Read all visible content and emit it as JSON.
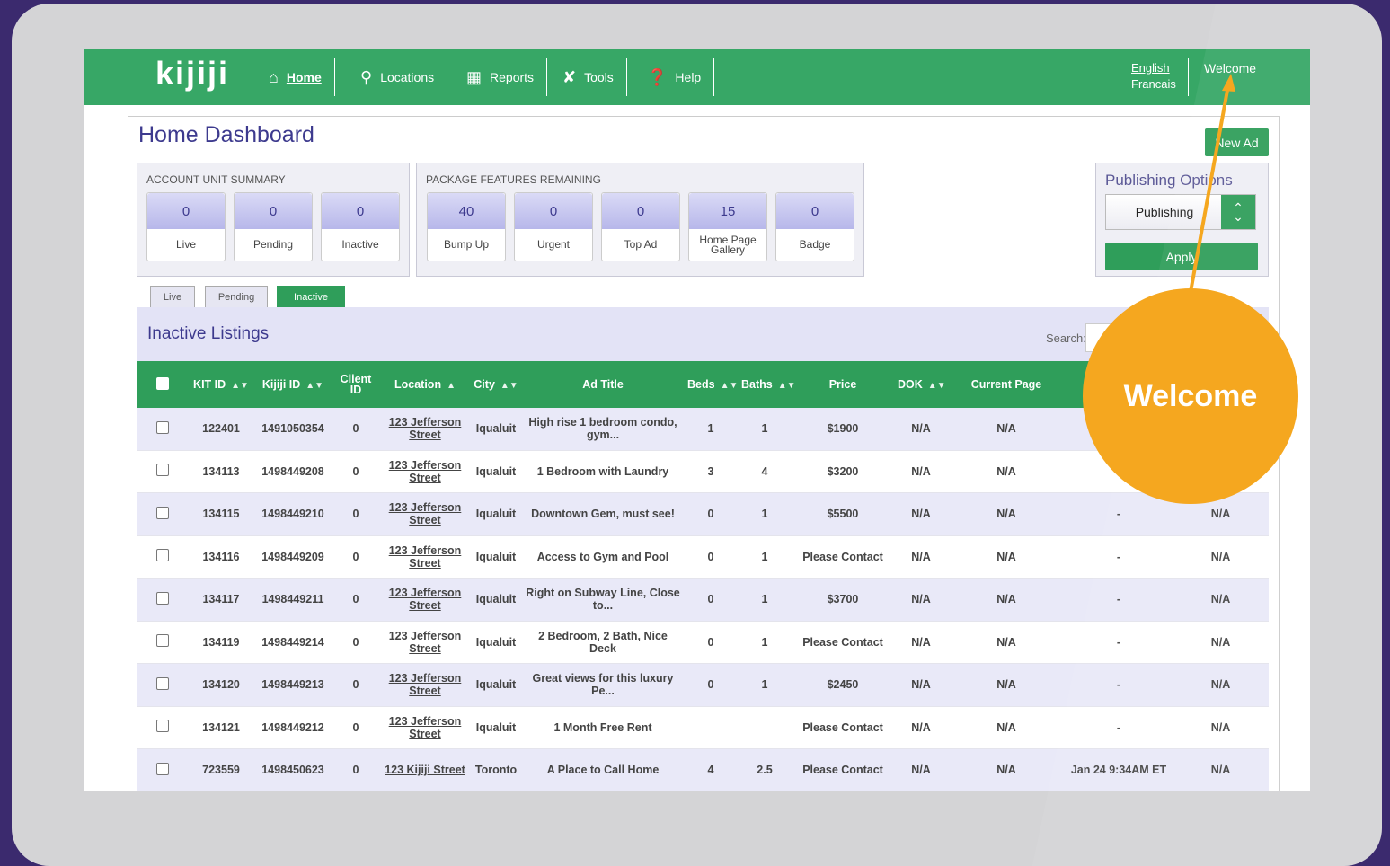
{
  "nav": {
    "logo": "kijiji",
    "items": [
      {
        "label": "Home",
        "icon": "home-icon"
      },
      {
        "label": "Locations",
        "icon": "map-pin-icon"
      },
      {
        "label": "Reports",
        "icon": "chart-icon"
      },
      {
        "label": "Tools",
        "icon": "tools-icon"
      },
      {
        "label": "Help",
        "icon": "help-icon"
      }
    ],
    "lang_en": "English",
    "lang_fr": "Francais",
    "welcome": "Welcome"
  },
  "page": {
    "title": "Home Dashboard",
    "new_ad": "New Ad"
  },
  "account_summary": {
    "title": "ACCOUNT UNIT SUMMARY",
    "cards": [
      {
        "value": "0",
        "label": "Live"
      },
      {
        "value": "0",
        "label": "Pending"
      },
      {
        "value": "0",
        "label": "Inactive"
      }
    ]
  },
  "package_features": {
    "title": "PACKAGE FEATURES REMAINING",
    "cards": [
      {
        "value": "40",
        "label": "Bump Up"
      },
      {
        "value": "0",
        "label": "Urgent"
      },
      {
        "value": "0",
        "label": "Top Ad"
      },
      {
        "value": "15",
        "label": "Home Page Gallery"
      },
      {
        "value": "0",
        "label": "Badge"
      }
    ]
  },
  "publishing": {
    "title": "Publishing Options",
    "selected": "Publishing",
    "apply": "Apply"
  },
  "tabs": [
    {
      "label": "Live",
      "active": false
    },
    {
      "label": "Pending",
      "active": false
    },
    {
      "label": "Inactive",
      "active": true
    }
  ],
  "listing": {
    "title": "Inactive Listings",
    "search_label": "Search:",
    "columns": [
      "KIT ID",
      "Kijiji ID",
      "Client ID",
      "Location",
      "City",
      "Ad Title",
      "Beds",
      "Baths",
      "Price",
      "DOK",
      "Current Page",
      "",
      ""
    ],
    "rows": [
      [
        "122401",
        "1491050354",
        "0",
        "123 Jefferson Street",
        "Iqualuit",
        "High rise 1 bedroom condo, gym...",
        "1",
        "1",
        "$1900",
        "N/A",
        "N/A",
        "",
        ""
      ],
      [
        "134113",
        "1498449208",
        "0",
        "123 Jefferson Street",
        "Iqualuit",
        "1 Bedroom with Laundry",
        "3",
        "4",
        "$3200",
        "N/A",
        "N/A",
        "",
        ""
      ],
      [
        "134115",
        "1498449210",
        "0",
        "123 Jefferson Street",
        "Iqualuit",
        "Downtown Gem, must see!",
        "0",
        "1",
        "$5500",
        "N/A",
        "N/A",
        "-",
        "N/A"
      ],
      [
        "134116",
        "1498449209",
        "0",
        "123 Jefferson Street",
        "Iqualuit",
        "Access to Gym and Pool",
        "0",
        "1",
        "Please Contact",
        "N/A",
        "N/A",
        "-",
        "N/A"
      ],
      [
        "134117",
        "1498449211",
        "0",
        "123 Jefferson Street",
        "Iqualuit",
        "Right on Subway Line, Close to...",
        "0",
        "1",
        "$3700",
        "N/A",
        "N/A",
        "-",
        "N/A"
      ],
      [
        "134119",
        "1498449214",
        "0",
        "123 Jefferson Street",
        "Iqualuit",
        "2 Bedroom, 2 Bath, Nice Deck",
        "0",
        "1",
        "Please Contact",
        "N/A",
        "N/A",
        "-",
        "N/A"
      ],
      [
        "134120",
        "1498449213",
        "0",
        "123 Jefferson Street",
        "Iqualuit",
        "Great views for this luxury Pe...",
        "0",
        "1",
        "$2450",
        "N/A",
        "N/A",
        "-",
        "N/A"
      ],
      [
        "134121",
        "1498449212",
        "0",
        "123 Jefferson Street",
        "Iqualuit",
        "1 Month Free Rent",
        "",
        "",
        "Please Contact",
        "N/A",
        "N/A",
        "-",
        "N/A"
      ],
      [
        "723559",
        "1498450623",
        "0",
        "123 Kijiji Street",
        "Toronto",
        "A Place to Call Home",
        "4",
        "2.5",
        "Please Contact",
        "N/A",
        "N/A",
        "Jan 24 9:34AM ET",
        "N/A"
      ]
    ]
  },
  "callout": {
    "label": "Welcome",
    "color": "#f5a71f"
  },
  "colors": {
    "brand_green": "#37a766",
    "accent_purple": "#3d3a8e",
    "background": "#3b2a6e"
  }
}
